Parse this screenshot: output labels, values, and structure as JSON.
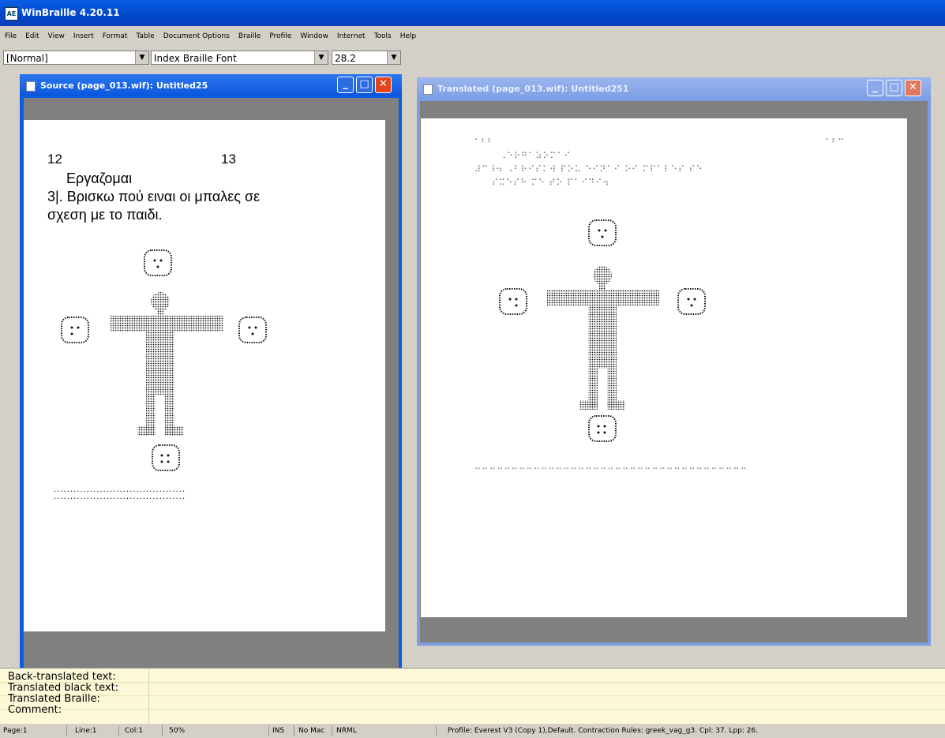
{
  "app": {
    "title": "WinBraille 4.20.11",
    "icon": "AE"
  },
  "menu": [
    "File",
    "Edit",
    "View",
    "Insert",
    "Format",
    "Table",
    "Document Options",
    "Braille",
    "Profile",
    "Window",
    "Internet",
    "Tools",
    "Help"
  ],
  "toolbar": {
    "style": "[Normal]",
    "font": "Index Braille Font",
    "size": "28.2"
  },
  "source_window": {
    "title": "Source (page_013.wif): Untitled25",
    "page_left": "12",
    "page_right": "13",
    "heading": "Εργαζομαι",
    "line1": "3|. Βρισκω πού ειναι οι μπαλες σε",
    "line2": "σχεση με το παιδι.",
    "dotted_rule": "........................................",
    "dotted_rule2": "........................................"
  },
  "translated_window": {
    "title": "Translated (page_013.wif): Untitled251",
    "braille_page_left": "⠁⠃⠃",
    "braille_page_right": "⠁⠃⠉",
    "braille_line1": "⠠⠑⠗⠛⠁⠵⠕⠍⠁⠊",
    "braille_line2": "⠼⠉⠸⠲ ⠠⠃⠗⠊⠎⠅⠺ ⠏⠕⠥ ⠑⠊⠝⠁⠊ ⠕⠊ ⠍⠏⠁⠇⠑⠎ ⠎⠑",
    "braille_line3": "⠎⠭⠑⠎⠓ ⠍⠑ ⠞⠕ ⠏⠁⠊⠙⠊⠲",
    "braille_rule": "⠒⠒⠒⠒⠒⠒⠒⠒⠒⠒⠒⠒⠒⠒⠒⠒⠒⠒⠒⠒⠒⠒⠒⠒⠒⠒⠒⠒⠒⠒⠒⠒⠒⠒⠒⠒⠒"
  },
  "text_panel": {
    "back_translated": "Back-translated text:",
    "translated_black": "Translated black text:",
    "translated_braille": "Translated Braille:",
    "comment": "Comment:"
  },
  "status": {
    "page": "Page:1",
    "line": "Line:1",
    "col": "Col:1",
    "zoom": "50%",
    "ins": "INS",
    "macro": "No Mac",
    "mode": "NRML",
    "profile": "Profile: Everest V3 (Copy 1),Default. Contraction Rules: greek_vag_g3. Cpl: 37. Lpp: 26."
  },
  "colors": {
    "title_active": "#0a5ee6",
    "title_inactive": "#7c9ee6",
    "close_red": "#e2441b",
    "panel_bg": "#fdf8d8"
  }
}
